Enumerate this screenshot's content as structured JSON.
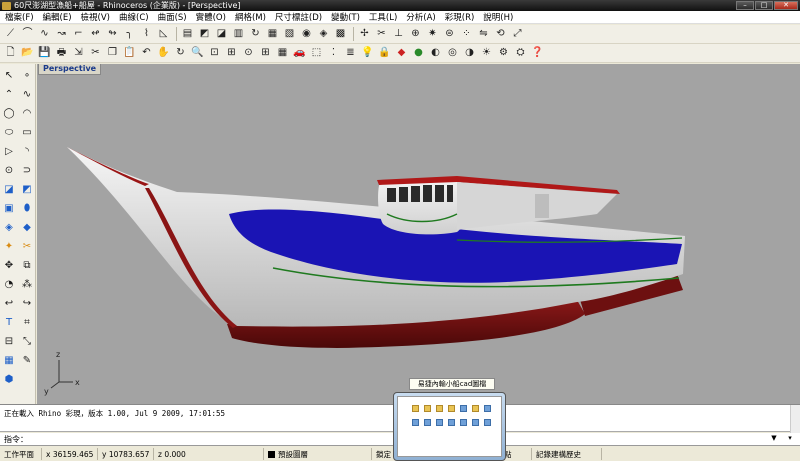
{
  "window": {
    "title": "60尺澎湖型漁船+船屋 - Rhinoceros (企業版) - [Perspective]",
    "buttons": {
      "minimize": "–",
      "maximize": "□",
      "close": "✕"
    }
  },
  "menu": [
    "檔案(F)",
    "編輯(E)",
    "檢視(V)",
    "曲線(C)",
    "曲面(S)",
    "實體(O)",
    "網格(M)",
    "尺寸標註(D)",
    "變動(T)",
    "工具(L)",
    "分析(A)",
    "彩現(R)",
    "說明(H)"
  ],
  "toolbar_row1_icons": [
    "line-icon",
    "arc-icon",
    "curve-icon",
    "freeform-icon",
    "polyline-icon",
    "spline-icon",
    "rebuild-icon",
    "fillet-icon",
    "blend-icon",
    "chamfer-icon",
    "extrude-icon",
    "loft-icon",
    "sweep1-icon",
    "sweep2-icon",
    "revolve-icon",
    "network-icon",
    "patch-icon",
    "cap-icon",
    "shell-icon",
    "mesh-icon",
    "fea-icon",
    "trim-icon",
    "split-icon",
    "join-icon",
    "explode-icon",
    "offset-icon",
    "array-icon",
    "mirror-icon",
    "rotate-icon",
    "scale-icon"
  ],
  "toolbar_row2_icons": [
    "new-icon",
    "open-icon",
    "save-icon",
    "print-icon",
    "import-icon",
    "cut-icon",
    "copy-icon",
    "paste-icon",
    "undo-icon",
    "pan-icon",
    "rotate-view-icon",
    "zoom-icon",
    "zoom-window-icon",
    "zoom-extents-icon",
    "zoom-selected-icon",
    "four-views-icon",
    "grid-icon",
    "car-icon",
    "select-icon",
    "point-icon",
    "layers-icon",
    "light-icon",
    "lock-icon",
    "material-icon",
    "color-icon",
    "render-icon",
    "sphere-icon",
    "shaded-icon",
    "sun-icon",
    "gear-icon",
    "settings-icon",
    "help-icon"
  ],
  "left_toolbar_icons": [
    "select-arrow-icon",
    "point-icon",
    "polyline-icon",
    "curve-icon",
    "circle-icon",
    "arc-icon",
    "ellipse-icon",
    "rectangle-icon",
    "polygon-icon",
    "curve-fillet-icon",
    "circle-point-icon",
    "offset-curve-icon",
    "surface-icon",
    "surface-edit-icon",
    "box-icon",
    "cylinder-icon",
    "solid-edit-icon",
    "solid-boolean-icon",
    "mesh-icon",
    "trim-icon",
    "move-icon",
    "copy-transform-icon",
    "analyze-icon",
    "dimension-icon",
    "text-icon",
    "array-icon",
    "flow-icon",
    "group-icon",
    "block-icon",
    "render-preview-icon"
  ],
  "viewport": {
    "label": "Perspective",
    "background": "#a3a3a3",
    "axis": {
      "x": "x",
      "y": "y",
      "z": "z"
    }
  },
  "command": {
    "history_line": "正在載入 Rhino 彩現，版本 1.00, Jul  9 2009, 17:01:55",
    "prompt_label": "指令：",
    "input_value": ""
  },
  "status": {
    "workplane": "工作平面",
    "x": "x 36159.465",
    "y": "y 10783.657",
    "z": "z 0.000",
    "layer": "預設圖層",
    "osnap": "鎖定",
    "points": "點",
    "history": "記錄建構歷史"
  },
  "thumbnail_popup": {
    "caption": "易捷內輸小船cad圖檔"
  },
  "colors": {
    "hull_white": "#e8e8e8",
    "hull_blue": "#1a14b4",
    "hull_red": "#7a1010",
    "stripe_green": "#1f7a1f",
    "titlebar": "#1a1a1a"
  }
}
